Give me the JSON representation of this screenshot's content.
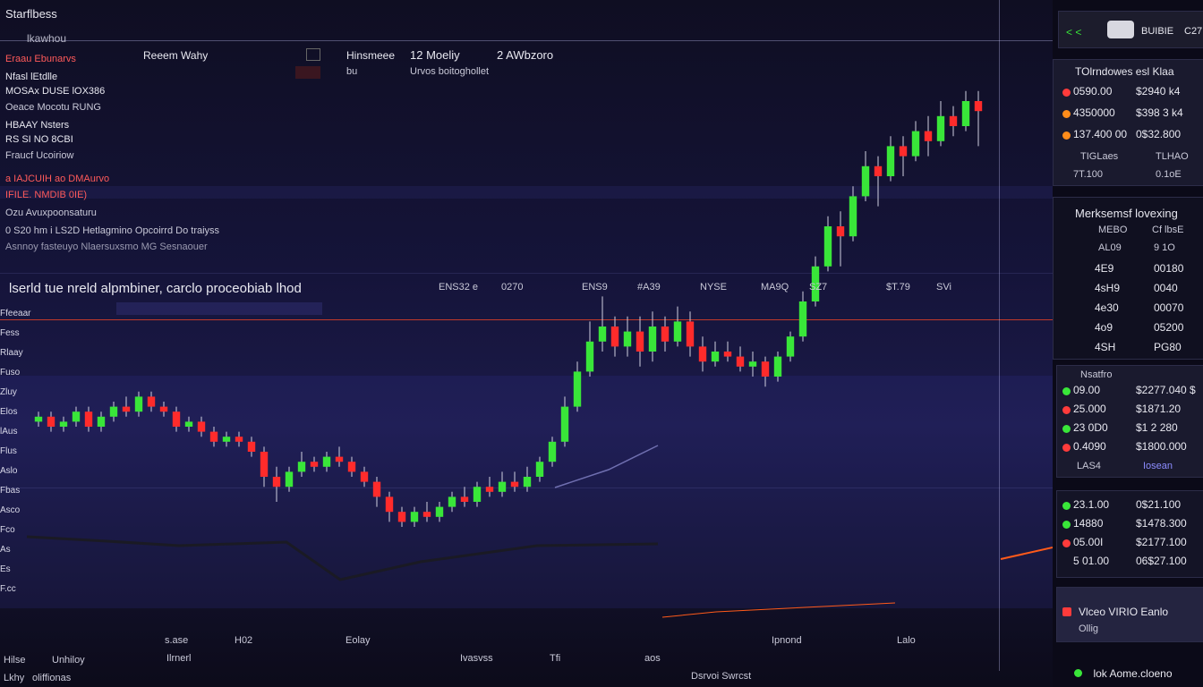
{
  "header": {
    "app_title": "Starflbess",
    "subtitle": "lkawhou",
    "tab1": "Reeem Wahy",
    "tab2": "Hinsmeee",
    "tab3_value": "12 Moeliy",
    "tab4_value": "2 AWbzoro",
    "tab3_sub": "bu",
    "tab4_sub": "Urvos boitoghollet"
  },
  "left_info": {
    "items": [
      {
        "text": "Eraau Ebunarvs",
        "color": "#ff5a5a"
      },
      {
        "text": "Nfasl lEtdlle",
        "color": "#e8e8f0"
      },
      {
        "text": "MOSAx DUSE lOX386",
        "color": "#e8e8f0"
      },
      {
        "text": "Oeace Mocotu RUNG",
        "color": "#c9c9d8"
      },
      {
        "text": "HBAAY Nsters",
        "color": "#e8e8f0"
      },
      {
        "text": "RS SI NO 8CBI",
        "color": "#e8e8f0"
      },
      {
        "text": "Fraucf Ucoiriow",
        "color": "#c9c9d8"
      },
      {
        "text": "a IAJCUIH ao DMAurvo",
        "color": "#ff5a5a"
      },
      {
        "text": "IFILE. NMDIB 0IE)",
        "color": "#ff5a5a"
      },
      {
        "text": "Ozu Avuxpoonsaturu",
        "color": "#c9c9d8"
      },
      {
        "text": "0 S20 hm i LS2D Hetlagmino Opcoirrd Do traiyss",
        "color": "#c9c9d8"
      },
      {
        "text": "Asnnoy fasteuyo Nlaersuxsmo MG Sesnaouer",
        "color": "#9a9ab0"
      }
    ]
  },
  "status_line": {
    "text": "lserld tue nreld alpmbiner, carclo proceobiab lhod",
    "ticks": [
      "ENS32 e",
      "0270",
      "ENS9",
      "#A39",
      "NYSE",
      "MA9Q",
      "SZ7",
      "$T.79",
      "SVi"
    ]
  },
  "axis_left": [
    "Ffeeaar",
    "Fess",
    "Rlaay",
    "Fuso",
    "Zluy",
    "Elos",
    "lAus",
    "Flus",
    "Aslo",
    "Fbas",
    "Asco",
    "Fco",
    "As",
    "Es",
    "F.cc"
  ],
  "bottom": {
    "labels": [
      "s.ase",
      "H02",
      "Eolay",
      "Ipnond",
      "Lalo"
    ],
    "row2": [
      "Hilse",
      "Unhiloy",
      "Ilrnerl",
      "Ivasvss",
      "Tfi",
      "aos"
    ],
    "row3": [
      "Lkhy",
      "oliffionas",
      "Dsrvoi Swrcst"
    ]
  },
  "right_panel": {
    "top_controls": [
      "< <",
      "BUIBIE",
      "C27"
    ],
    "order_book_title": "TOlrndowes esl Klaa",
    "order_rows": [
      {
        "left": "0590.00",
        "right": "$2940 k4",
        "dot": "#ff3b3b"
      },
      {
        "left": "4350000",
        "right": "$398 3 k4",
        "dot": "#ff8c1a"
      },
      {
        "left": "137.400 00",
        "right": "0$32.800",
        "dot": "#ff8c1a"
      }
    ],
    "sub_rows": [
      {
        "left": "TIGLaes",
        "right": "TLHAO"
      },
      {
        "left": "7T.100",
        "right": "0.1oE"
      }
    ],
    "market_title": "Merksemsf lovexing",
    "market_header": [
      "MEBO",
      "Cf lbsE"
    ],
    "market_sub": [
      "AL09",
      "9 1O"
    ],
    "market_rows": [
      {
        "left": "4E9",
        "right": "00180"
      },
      {
        "left": "4sH9",
        "right": "0040"
      },
      {
        "left": "4e30",
        "right": "00070"
      },
      {
        "left": "4o9",
        "right": "05200"
      },
      {
        "left": "4SH",
        "right": "PG80"
      }
    ],
    "trades_title": "Nsatfro",
    "trade_rows": [
      {
        "left": "09.00",
        "right": "$2277.040 $",
        "dot": "#39e639"
      },
      {
        "left": "25.000",
        "right": "$1871.20",
        "dot": "#ff3b3b"
      },
      {
        "left": "23 0D0",
        "right": "$1 2 280",
        "dot": "#39e639"
      },
      {
        "left": "0.4090",
        "right": "$1800.000",
        "dot": "#ff3b3b"
      }
    ],
    "trade_footer": [
      "LAS4",
      "Iosean"
    ],
    "positions": [
      {
        "left": "23.1.00",
        "right": "0$21.100",
        "dot": "#39e639"
      },
      {
        "left": "14880",
        "right": "$1478.300",
        "dot": "#39e639"
      },
      {
        "left": "05.00I",
        "right": "$2177.100",
        "dot": "#ff3b3b"
      },
      {
        "left": "5 01.00",
        "right": "06$27.100",
        "dot": ""
      }
    ],
    "alert_title": "Vlceo VIRIO Eanlo",
    "alert_sub": "Ollig",
    "footer_status": "lok Aome.cloeno"
  },
  "colors": {
    "up": "#39e639",
    "down": "#ff2b2b",
    "accent": "#4d5dff",
    "bg": "#0d0c1c"
  },
  "chart_data": {
    "type": "candlestick",
    "candles": [
      [
        0.31,
        0.32,
        0.3,
        0.33
      ],
      [
        0.32,
        0.3,
        0.29,
        0.33
      ],
      [
        0.3,
        0.31,
        0.29,
        0.32
      ],
      [
        0.31,
        0.33,
        0.3,
        0.34
      ],
      [
        0.33,
        0.3,
        0.29,
        0.34
      ],
      [
        0.3,
        0.32,
        0.29,
        0.33
      ],
      [
        0.32,
        0.34,
        0.31,
        0.35
      ],
      [
        0.34,
        0.33,
        0.32,
        0.36
      ],
      [
        0.33,
        0.36,
        0.32,
        0.37
      ],
      [
        0.36,
        0.34,
        0.33,
        0.37
      ],
      [
        0.34,
        0.33,
        0.32,
        0.35
      ],
      [
        0.33,
        0.3,
        0.29,
        0.34
      ],
      [
        0.3,
        0.31,
        0.29,
        0.32
      ],
      [
        0.31,
        0.29,
        0.28,
        0.32
      ],
      [
        0.29,
        0.27,
        0.26,
        0.3
      ],
      [
        0.27,
        0.28,
        0.26,
        0.29
      ],
      [
        0.28,
        0.27,
        0.26,
        0.29
      ],
      [
        0.27,
        0.25,
        0.24,
        0.28
      ],
      [
        0.25,
        0.2,
        0.18,
        0.26
      ],
      [
        0.2,
        0.18,
        0.15,
        0.22
      ],
      [
        0.18,
        0.21,
        0.17,
        0.22
      ],
      [
        0.21,
        0.23,
        0.2,
        0.25
      ],
      [
        0.23,
        0.22,
        0.21,
        0.24
      ],
      [
        0.22,
        0.24,
        0.21,
        0.25
      ],
      [
        0.24,
        0.23,
        0.22,
        0.26
      ],
      [
        0.23,
        0.21,
        0.2,
        0.24
      ],
      [
        0.21,
        0.19,
        0.18,
        0.22
      ],
      [
        0.19,
        0.16,
        0.14,
        0.2
      ],
      [
        0.16,
        0.13,
        0.11,
        0.17
      ],
      [
        0.13,
        0.11,
        0.1,
        0.14
      ],
      [
        0.11,
        0.13,
        0.1,
        0.14
      ],
      [
        0.13,
        0.12,
        0.11,
        0.15
      ],
      [
        0.12,
        0.14,
        0.11,
        0.15
      ],
      [
        0.14,
        0.16,
        0.13,
        0.17
      ],
      [
        0.16,
        0.15,
        0.14,
        0.18
      ],
      [
        0.15,
        0.18,
        0.14,
        0.19
      ],
      [
        0.18,
        0.17,
        0.16,
        0.2
      ],
      [
        0.17,
        0.19,
        0.16,
        0.21
      ],
      [
        0.19,
        0.18,
        0.17,
        0.21
      ],
      [
        0.18,
        0.2,
        0.17,
        0.22
      ],
      [
        0.2,
        0.23,
        0.19,
        0.24
      ],
      [
        0.23,
        0.27,
        0.22,
        0.28
      ],
      [
        0.27,
        0.34,
        0.26,
        0.36
      ],
      [
        0.34,
        0.41,
        0.33,
        0.43
      ],
      [
        0.41,
        0.47,
        0.4,
        0.51
      ],
      [
        0.47,
        0.5,
        0.45,
        0.56
      ],
      [
        0.5,
        0.46,
        0.44,
        0.52
      ],
      [
        0.46,
        0.49,
        0.44,
        0.52
      ],
      [
        0.49,
        0.45,
        0.42,
        0.52
      ],
      [
        0.45,
        0.5,
        0.43,
        0.53
      ],
      [
        0.5,
        0.47,
        0.45,
        0.52
      ],
      [
        0.47,
        0.51,
        0.46,
        0.54
      ],
      [
        0.51,
        0.46,
        0.44,
        0.53
      ],
      [
        0.46,
        0.43,
        0.41,
        0.48
      ],
      [
        0.43,
        0.45,
        0.42,
        0.47
      ],
      [
        0.45,
        0.44,
        0.43,
        0.47
      ],
      [
        0.44,
        0.42,
        0.41,
        0.46
      ],
      [
        0.42,
        0.43,
        0.4,
        0.45
      ],
      [
        0.43,
        0.4,
        0.38,
        0.44
      ],
      [
        0.4,
        0.44,
        0.39,
        0.45
      ],
      [
        0.44,
        0.48,
        0.43,
        0.49
      ],
      [
        0.48,
        0.55,
        0.47,
        0.57
      ],
      [
        0.55,
        0.62,
        0.54,
        0.64
      ],
      [
        0.62,
        0.7,
        0.61,
        0.72
      ],
      [
        0.7,
        0.68,
        0.62,
        0.73
      ],
      [
        0.68,
        0.76,
        0.67,
        0.78
      ],
      [
        0.76,
        0.82,
        0.75,
        0.85
      ],
      [
        0.82,
        0.8,
        0.74,
        0.84
      ],
      [
        0.8,
        0.86,
        0.79,
        0.88
      ],
      [
        0.86,
        0.84,
        0.8,
        0.88
      ],
      [
        0.84,
        0.89,
        0.83,
        0.91
      ],
      [
        0.89,
        0.87,
        0.84,
        0.92
      ],
      [
        0.87,
        0.92,
        0.86,
        0.95
      ],
      [
        0.92,
        0.9,
        0.88,
        0.94
      ],
      [
        0.9,
        0.95,
        0.89,
        0.97
      ],
      [
        0.95,
        0.93,
        0.86,
        0.97
      ]
    ],
    "ylim": [
      0.0,
      1.0
    ]
  }
}
